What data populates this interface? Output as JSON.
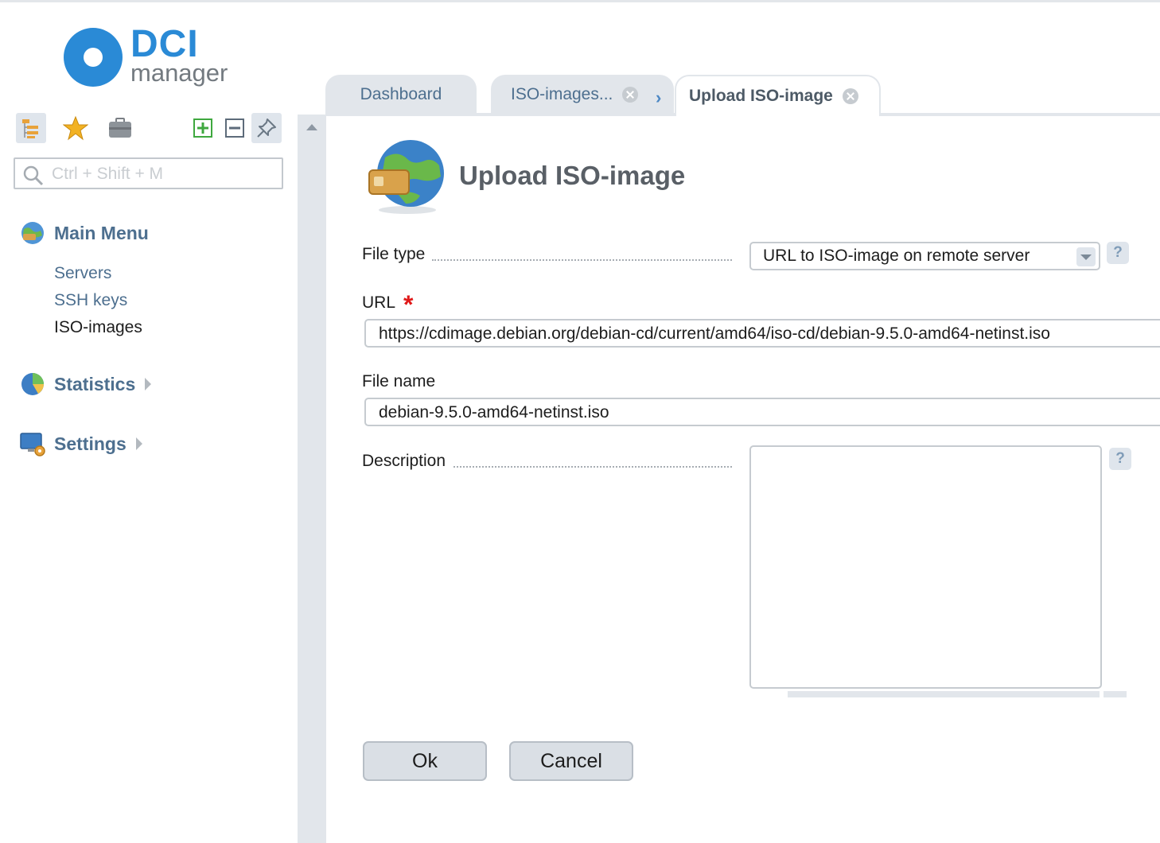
{
  "logo": {
    "brand": "DCI",
    "sub": "manager"
  },
  "search": {
    "placeholder": "Ctrl + Shift + M"
  },
  "sidebar": {
    "toolbar": [
      "tree-icon",
      "star-icon",
      "briefcase-icon",
      "expand-all-icon",
      "collapse-all-icon",
      "pin-icon"
    ],
    "sections": [
      {
        "label": "Main Menu",
        "icon": "globe-icon",
        "items": [
          "Servers",
          "SSH keys",
          "ISO-images"
        ]
      },
      {
        "label": "Statistics",
        "icon": "pie-chart-icon"
      },
      {
        "label": "Settings",
        "icon": "monitor-gear-icon"
      }
    ]
  },
  "tabs": [
    {
      "label": "Dashboard"
    },
    {
      "label": "ISO-images..."
    },
    {
      "label": "Upload ISO-image"
    }
  ],
  "page": {
    "title": "Upload ISO-image"
  },
  "form": {
    "file_type": {
      "label": "File type",
      "value": "URL to ISO-image on remote server",
      "help": "?"
    },
    "url": {
      "label": "URL",
      "required_mark": "*",
      "value": "https://cdimage.debian.org/debian-cd/current/amd64/iso-cd/debian-9.5.0-amd64-netinst.iso"
    },
    "file_name": {
      "label": "File name",
      "value": "debian-9.5.0-amd64-netinst.iso"
    },
    "description": {
      "label": "Description",
      "value": "",
      "help": "?"
    }
  },
  "buttons": {
    "ok": "Ok",
    "cancel": "Cancel"
  },
  "colors": {
    "accent": "#2a8ad6",
    "menu_text": "#4d6f8f",
    "required": "#e01919",
    "panel": "#e2e6eb"
  }
}
